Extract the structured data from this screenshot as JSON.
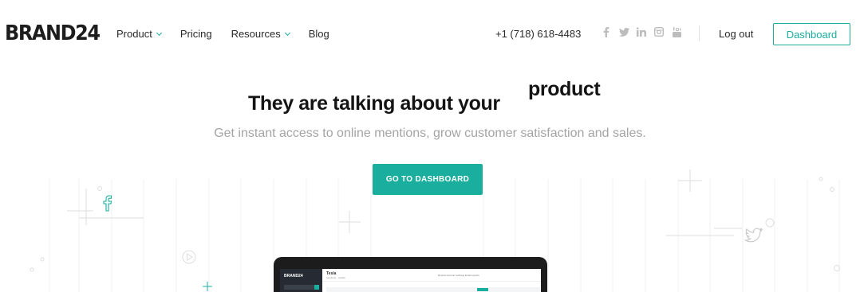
{
  "nav": {
    "logo": "BRAND24",
    "menu": [
      {
        "label": "Product",
        "has_dropdown": true
      },
      {
        "label": "Pricing",
        "has_dropdown": false
      },
      {
        "label": "Resources",
        "has_dropdown": true
      },
      {
        "label": "Blog",
        "has_dropdown": false
      }
    ],
    "phone": "+1 (718) 618-4483",
    "socials": [
      "facebook-icon",
      "twitter-icon",
      "linkedin-icon",
      "instagram-icon",
      "youtube-icon"
    ],
    "logout_label": "Log out",
    "dashboard_label": "Dashboard"
  },
  "hero": {
    "title": "They are talking about your",
    "title_word": "product",
    "subtitle": "Get instant access to online mentions, grow customer satisfaction and sales.",
    "cta_label": "GO TO DASHBOARD"
  },
  "preview": {
    "logo": "BRAND24",
    "project_title": "Tesla",
    "project_sub": "mentions · results",
    "tabs": "Reports    Account settings    Email reports"
  },
  "colors": {
    "accent": "#1aae9f",
    "text": "#222222",
    "muted": "#a4a4a4",
    "social_grey": "#bdbdbd"
  }
}
